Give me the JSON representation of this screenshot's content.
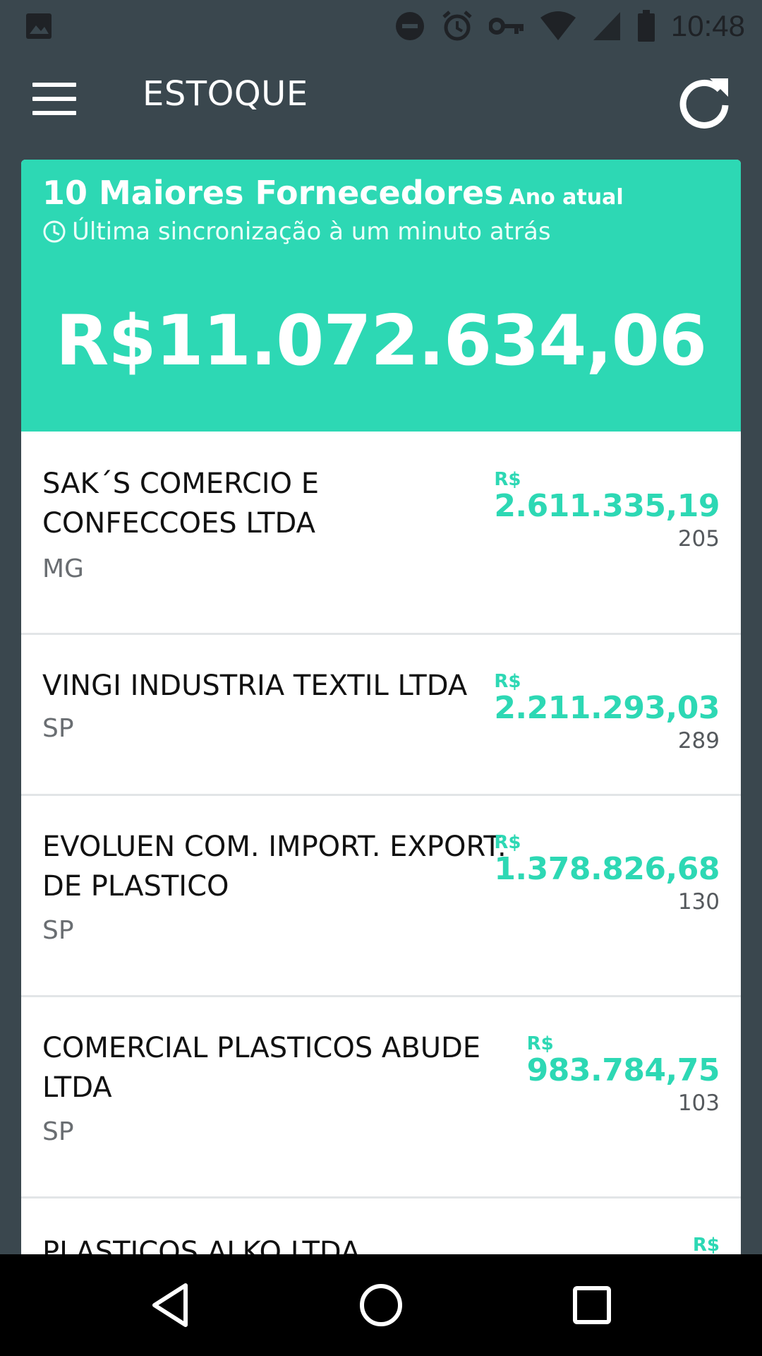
{
  "status_bar": {
    "time": "10:48",
    "icons": [
      "image-icon",
      "do-not-disturb-icon",
      "alarm-icon",
      "vpn-key-icon",
      "wifi-icon",
      "signal-icon",
      "battery-icon"
    ]
  },
  "app_bar": {
    "title": "ESTOQUE",
    "menu_icon": "menu-icon",
    "refresh_icon": "refresh-icon"
  },
  "summary": {
    "title": "10 Maiores Fornecedores",
    "period": "Ano atual",
    "sync_text": "Última sincronização à um minuto atrás",
    "total": "R$11.072.634,06"
  },
  "suppliers": [
    {
      "name": "SAK´S COMERCIO E CONFECCOES LTDA",
      "state": "MG",
      "currency": "R$",
      "value": "2.611.335,19",
      "count": "205"
    },
    {
      "name": "VINGI INDUSTRIA TEXTIL LTDA",
      "state": "SP",
      "currency": "R$",
      "value": "2.211.293,03",
      "count": "289"
    },
    {
      "name": "EVOLUEN COM. IMPORT. EXPORT. DE PLASTICO",
      "state": "SP",
      "currency": "R$",
      "value": "1.378.826,68",
      "count": "130"
    },
    {
      "name": "COMERCIAL PLASTICOS ABUDE LTDA",
      "state": "SP",
      "currency": "R$",
      "value": "983.784,75",
      "count": "103"
    },
    {
      "name": "PLASTICOS ALKO LTDA",
      "currency": "R$"
    }
  ],
  "colors": {
    "accent": "#2dd8b4",
    "app_bar": "#3a474e",
    "nav_bar": "#000000"
  }
}
